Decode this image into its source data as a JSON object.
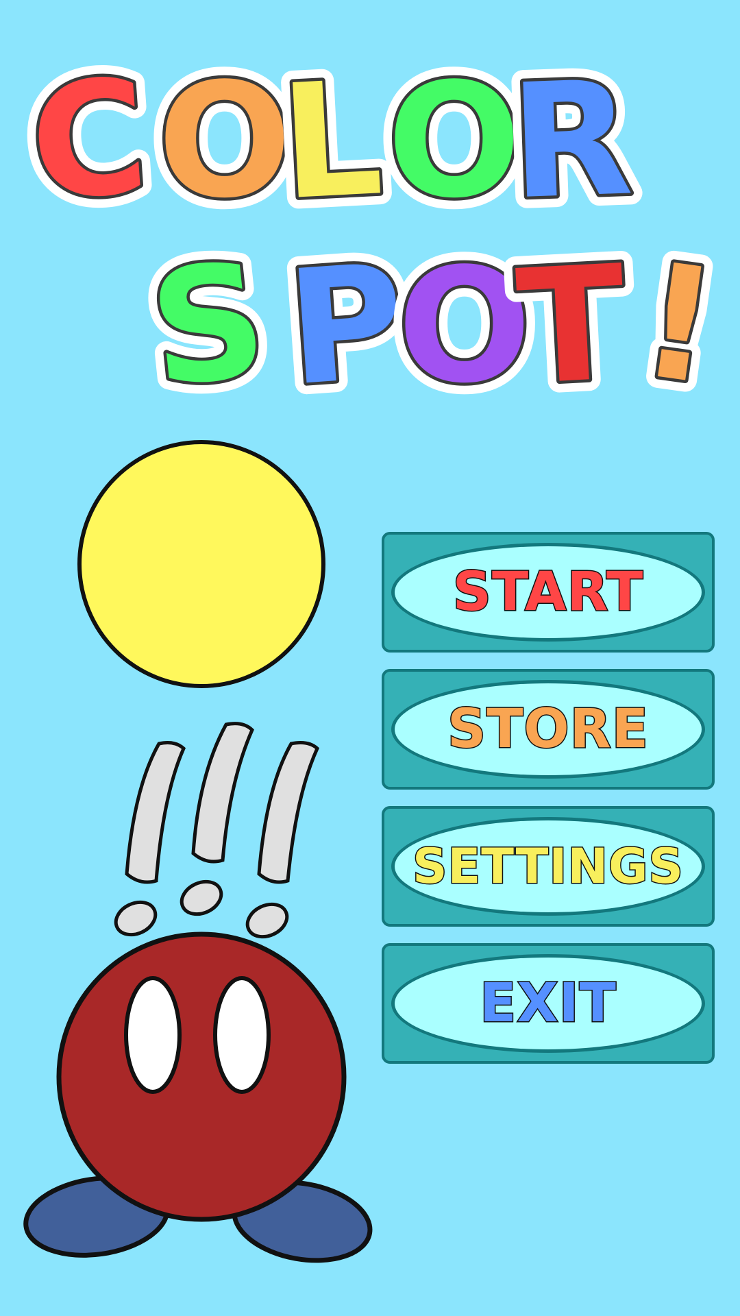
{
  "title": {
    "line1": [
      {
        "ch": "C",
        "color": "#ff4646"
      },
      {
        "ch": "O",
        "color": "#f9a552"
      },
      {
        "ch": "L",
        "color": "#f8ef5d"
      },
      {
        "ch": "O",
        "color": "#44fb66"
      },
      {
        "ch": "R",
        "color": "#5590ff"
      }
    ],
    "line2": [
      {
        "ch": "S",
        "color": "#44fb66"
      },
      {
        "ch": "P",
        "color": "#5590ff"
      },
      {
        "ch": "O",
        "color": "#a152f2"
      },
      {
        "ch": "T",
        "color": "#e83232"
      },
      {
        "ch": "!",
        "color": "#f9a552"
      }
    ]
  },
  "menu": {
    "start": {
      "label": "START",
      "color": "#ff4646"
    },
    "store": {
      "label": "STORE",
      "color": "#f9a552"
    },
    "settings": {
      "label": "SETTINGS",
      "color": "#f8ef5d"
    },
    "exit": {
      "label": "EXIT",
      "color": "#5590ff"
    }
  },
  "colors": {
    "background": "#8be5fd",
    "color_spot": "#fff85c",
    "character_body": "#a92828",
    "character_feet": "#41609a"
  }
}
